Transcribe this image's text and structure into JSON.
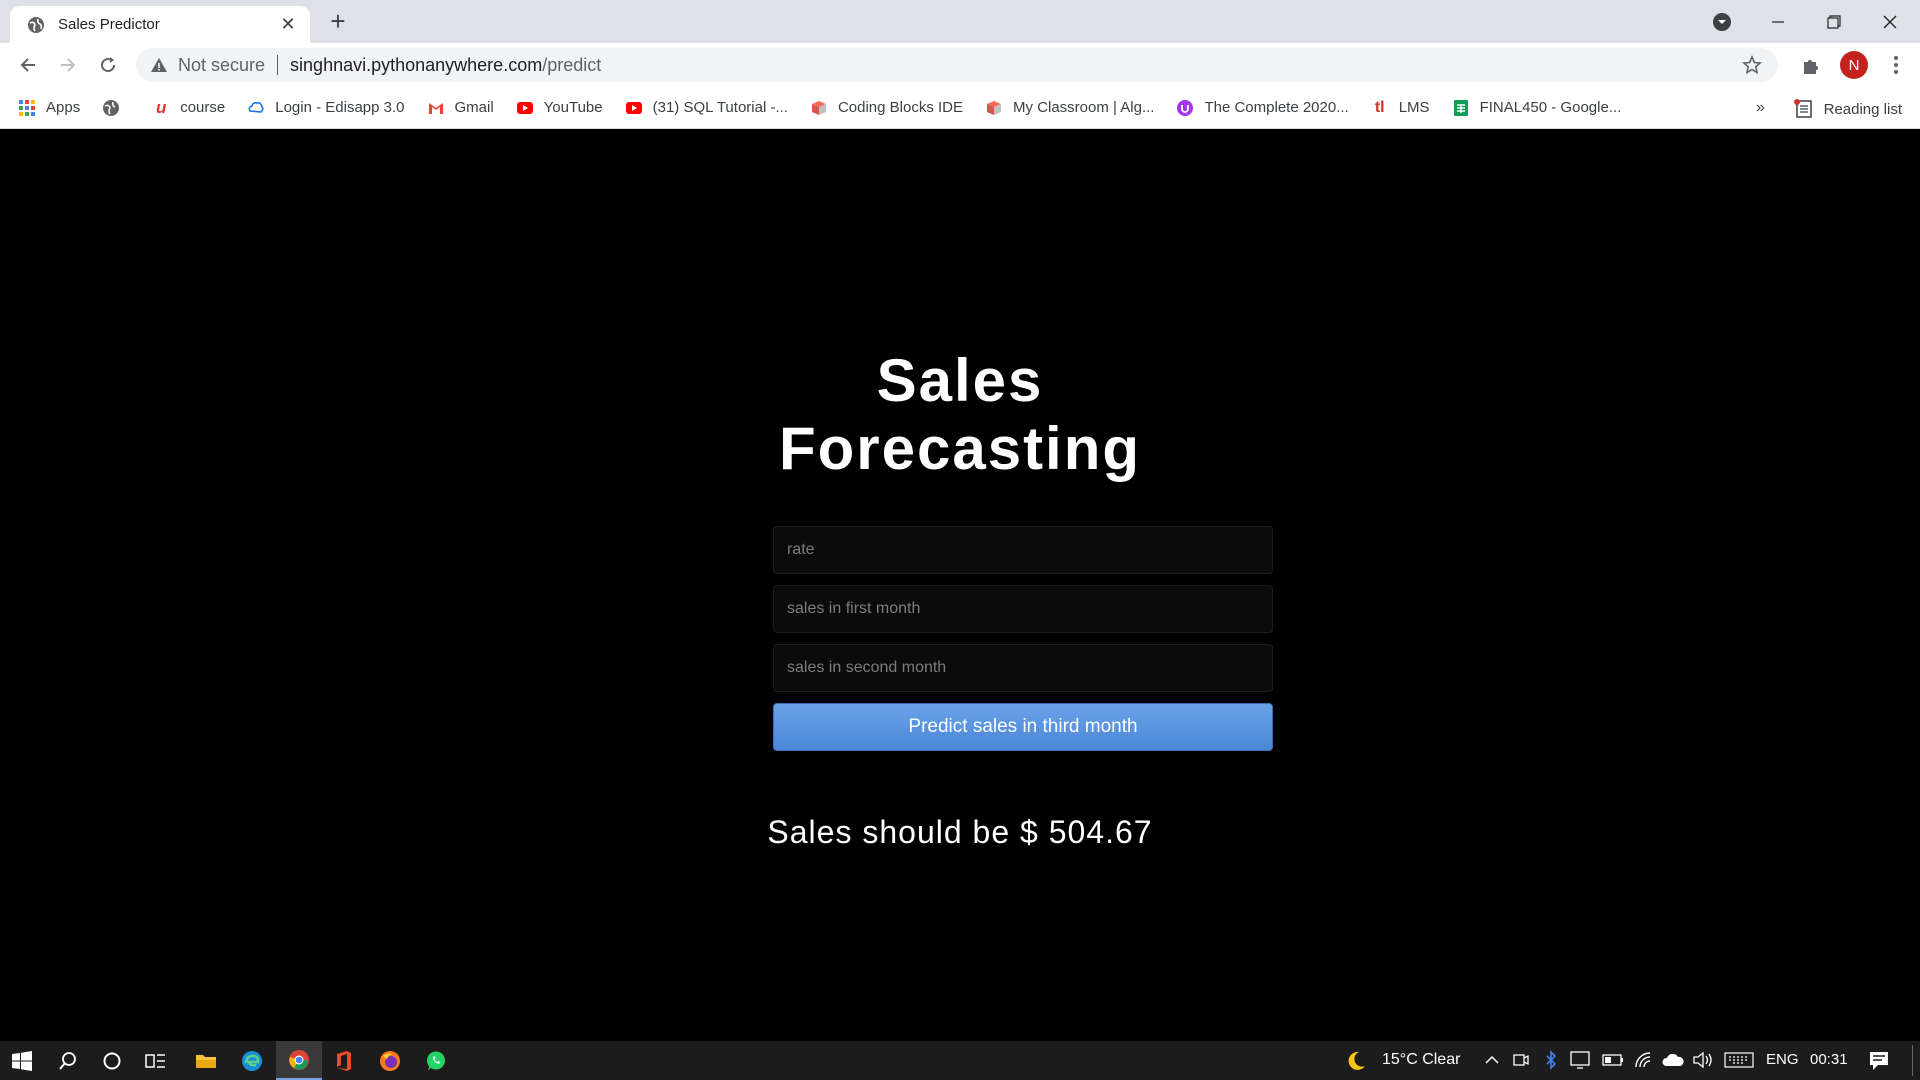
{
  "browser": {
    "tab_title": "Sales Predictor",
    "omnibox": {
      "security_label": "Not secure",
      "url_host": "singhnavi.pythonanywhere.com",
      "url_path": "/predict"
    },
    "profile_initial": "N",
    "bookmarks": [
      {
        "label": "Apps",
        "icon": "apps-grid-icon"
      },
      {
        "label": "",
        "icon": "globe-icon"
      },
      {
        "label": "course",
        "icon": "udemy-icon"
      },
      {
        "label": "Login - Edisapp 3.0",
        "icon": "edisapp-icon"
      },
      {
        "label": "Gmail",
        "icon": "gmail-icon"
      },
      {
        "label": "YouTube",
        "icon": "youtube-icon"
      },
      {
        "label": "(31) SQL Tutorial -...",
        "icon": "youtube-icon"
      },
      {
        "label": "Coding Blocks IDE",
        "icon": "coding-blocks-icon"
      },
      {
        "label": "My Classroom | Alg...",
        "icon": "coding-blocks-icon"
      },
      {
        "label": "The Complete 2020...",
        "icon": "udemy-course-icon"
      },
      {
        "label": "LMS",
        "icon": "lms-icon"
      },
      {
        "label": "FINAL450 - Google...",
        "icon": "google-sheets-icon"
      }
    ],
    "bookmarks_overflow": "»",
    "reading_list_label": "Reading list"
  },
  "page": {
    "heading_line1": "Sales",
    "heading_line2": "Forecasting",
    "fields": {
      "rate_placeholder": "rate",
      "first_month_placeholder": "sales in first month",
      "second_month_placeholder": "sales in second month"
    },
    "predict_button_label": "Predict sales in third month",
    "result_text": "Sales should be $ 504.67"
  },
  "taskbar": {
    "weather": "15°C  Clear",
    "language": "ENG",
    "time": "00:31"
  },
  "colors": {
    "page_background": "#000000",
    "button_blue": "#4a86d7",
    "profile_red": "#c5221f"
  }
}
